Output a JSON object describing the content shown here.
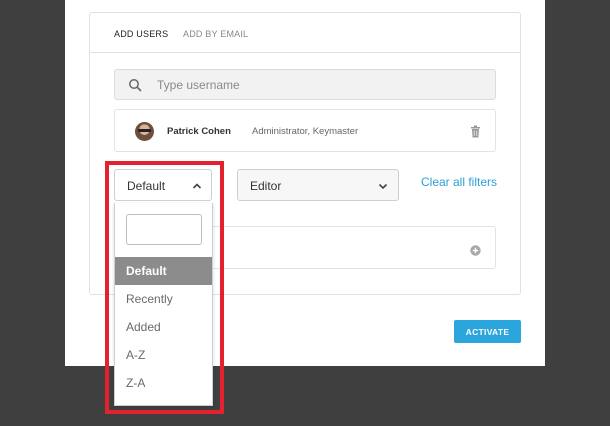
{
  "tabs": [
    {
      "label": "ADD USERS",
      "active": true
    },
    {
      "label": "ADD BY EMAIL",
      "active": false
    }
  ],
  "search": {
    "placeholder": "Type username",
    "value": ""
  },
  "selected_user": {
    "name": "Patrick Cohen",
    "roles": "Administrator, Keymaster"
  },
  "filters": {
    "sort_value": "Default",
    "role_value": "Editor",
    "clear_label": "Clear all filters"
  },
  "sort_dropdown": {
    "search_value": "",
    "options": [
      "Default",
      "Recently",
      "Added",
      "A-Z",
      "Z-A"
    ],
    "selected_index": 0
  },
  "actions": {
    "activate_label": "ACTIVATE"
  },
  "colors": {
    "accent": "#2aa6dc",
    "link": "#2a9fd6",
    "highlight": "#e3212f",
    "overlay": "#3f3f3f",
    "selected_option": "#8c8c8c"
  },
  "icons": {
    "search": "search-icon",
    "trash": "trash-icon",
    "chevron_up": "chevron-up-icon",
    "chevron_down": "chevron-down-icon",
    "plus": "plus-circle-icon"
  }
}
